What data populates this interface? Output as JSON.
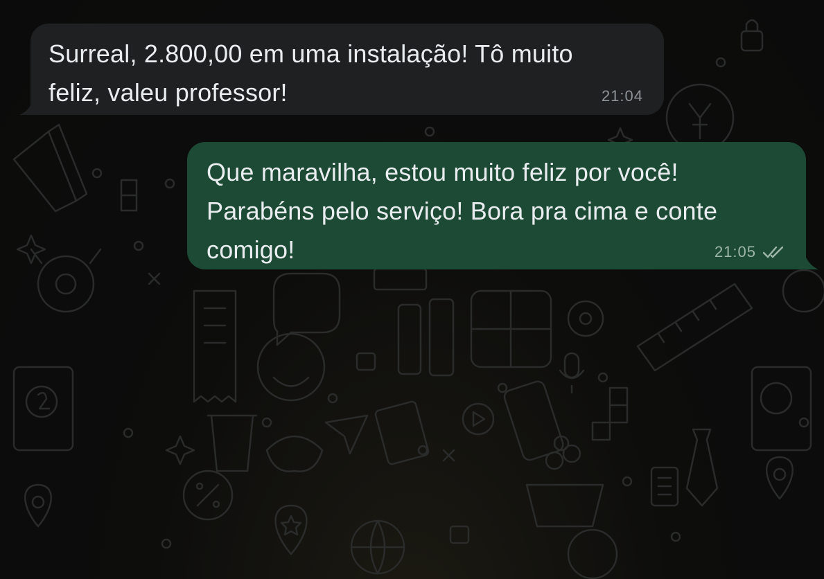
{
  "colors": {
    "background": "#0b0c0c",
    "incoming_bubble": "#1f2021",
    "outgoing_bubble": "#1d4a35",
    "message_text": "#e9edef",
    "timestamp": "#8f9498"
  },
  "messages": [
    {
      "direction": "incoming",
      "text": "Surreal, 2.800,00 em uma instalação! Tô muito\nfeliz, valeu professor!",
      "time": "21:04"
    },
    {
      "direction": "outgoing",
      "text": "Que maravilha, estou muito feliz por você!\nParabéns pelo serviço! Bora pra cima e conte\ncomigo!",
      "time": "21:05",
      "status_icon": "double-check-icon"
    }
  ]
}
